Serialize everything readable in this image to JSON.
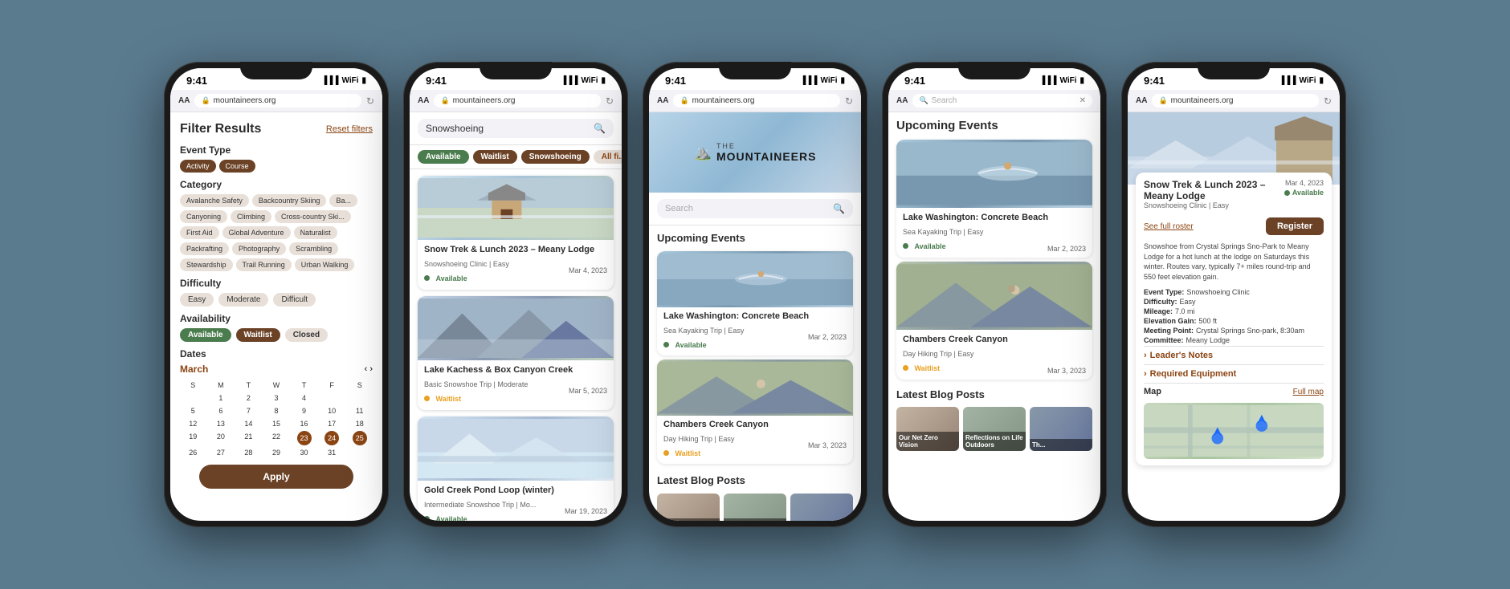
{
  "app": {
    "time": "9:41",
    "url": "mountaineers.org",
    "url2": "mountaineers.org"
  },
  "phone1": {
    "title": "Filter Results",
    "reset": "Reset filters",
    "event_type_label": "Event Type",
    "event_types": [
      "Activity",
      "Course"
    ],
    "category_label": "Category",
    "categories_row1": [
      "Avalanche Safety",
      "Backcountry Skiing",
      "Ba..."
    ],
    "categories_row2": [
      "Canyoning",
      "Climbing",
      "Cross-country Ski..."
    ],
    "categories_row3": [
      "First Aid",
      "Global Adventure",
      "Naturalist"
    ],
    "categories_row4": [
      "Packrafting",
      "Photography",
      "Scrambling"
    ],
    "categories_row5": [
      "Stewardship",
      "Trail Running",
      "Urban Walking"
    ],
    "difficulty_label": "Difficulty",
    "difficulties": [
      "Easy",
      "Moderate",
      "Difficult"
    ],
    "availability_label": "Availability",
    "available": "Available",
    "waitlist": "Waitlist",
    "closed": "Closed",
    "dates_label": "Dates",
    "month": "March",
    "cal_days_header": [
      "S",
      "M",
      "T",
      "W",
      "T",
      "F",
      "S"
    ],
    "cal_week1": [
      "",
      "1",
      "2",
      "3",
      "4"
    ],
    "cal_week2": [
      "5",
      "6",
      "7",
      "8",
      "9",
      "10",
      "11"
    ],
    "cal_week3": [
      "12",
      "13",
      "14",
      "15",
      "16",
      "17",
      "18"
    ],
    "cal_week4": [
      "19",
      "20",
      "21",
      "22",
      "23",
      "24",
      "25"
    ],
    "cal_week5": [
      "26",
      "27",
      "28",
      "29",
      "30",
      "31"
    ],
    "apply_btn": "Apply"
  },
  "phone2": {
    "search_value": "Snowshoeing",
    "chips": [
      "Available",
      "Waitlist",
      "Snowshoeing",
      "All fi..."
    ],
    "results": [
      {
        "title": "Snow Trek & Lunch 2023 – Meany Lodge",
        "date": "Mar 4, 2023",
        "sub": "Snowshoeing Clinic | Easy",
        "status": "Available",
        "img_class": "img-snow-lodge"
      },
      {
        "title": "Lake Kachess & Box Canyon Creek",
        "date": "Mar 5, 2023",
        "sub": "Basic Snowshoe Trip | Moderate",
        "status": "Waitlist",
        "img_class": "img-mountains"
      },
      {
        "title": "Gold Creek Pond Loop (winter)",
        "date": "Mar 19, 2023",
        "sub": "Intermediate Snowshoe Trip | Mo...",
        "status": "Available",
        "img_class": "img-winter-pond"
      }
    ]
  },
  "phone3": {
    "logo_the": "THE",
    "logo_main": "MOUNTAINEERS",
    "search_placeholder": "Search",
    "upcoming_events": "Upcoming Events",
    "events": [
      {
        "title": "Lake Washington: Concrete Beach",
        "date": "Mar 2, 2023",
        "sub": "Sea Kayaking Trip | Easy",
        "status": "Available",
        "img_class": "img-kayak"
      },
      {
        "title": "Chambers Creek Canyon",
        "date": "Mar 3, 2023",
        "sub": "Day Hiking Trip | Easy",
        "status": "Waitlist",
        "img_class": "img-hiking"
      }
    ],
    "blog_title": "Latest Blog Posts"
  },
  "phone4": {
    "search_placeholder": "Search",
    "upcoming_events": "Upcoming Events",
    "events": [
      {
        "title": "Lake Washington: Concrete Beach",
        "date": "Mar 2, 2023",
        "sub": "Sea Kayaking Trip | Easy",
        "status": "Available",
        "img_class": "img-kayak"
      },
      {
        "title": "Chambers Creek Canyon",
        "date": "Mar 3, 2023",
        "sub": "Day Hiking Trip | Easy",
        "status": "Waitlist",
        "img_class": "img-hiking"
      }
    ],
    "blog_title": "Latest Blog Posts",
    "blog_posts": [
      {
        "title": "Our Net Zero Vision",
        "img_class": "img-blog1"
      },
      {
        "title": "Reflections on Life Outdoors",
        "img_class": "img-blog2"
      },
      {
        "title": "Th...",
        "img_class": "img-mountains"
      }
    ]
  },
  "phone5": {
    "event_title": "Snow Trek & Lunch 2023 – Meany Lodge",
    "event_date": "Mar 4, 2023",
    "event_sub": "Snowshoeing Clinic | Easy",
    "status": "Available",
    "see_roster": "See full roster",
    "register": "Register",
    "description": "Snowshoe from Crystal Springs Sno-Park to Meany Lodge for a hot lunch at the lodge on Saturdays this winter. Routes vary, typically 7+ miles round-trip and 550 feet elevation gain.",
    "event_type_label": "Event Type:",
    "event_type_value": "Snowshoeing Clinic",
    "difficulty_label": "Difficulty:",
    "difficulty_value": "Easy",
    "mileage_label": "Mileage:",
    "mileage_value": "7.0 mi",
    "elevation_label": "Elevation Gain:",
    "elevation_value": "500 ft",
    "meeting_label": "Meeting Point:",
    "meeting_value": "Crystal Springs Sno-park, 8:30am",
    "committee_label": "Committee:",
    "committee_value": "Meany Lodge",
    "leaders_notes": "Leader's Notes",
    "required_equipment": "Required Equipment",
    "map_label": "Map",
    "full_map": "Full map",
    "img_class": "img-detail-hero"
  }
}
